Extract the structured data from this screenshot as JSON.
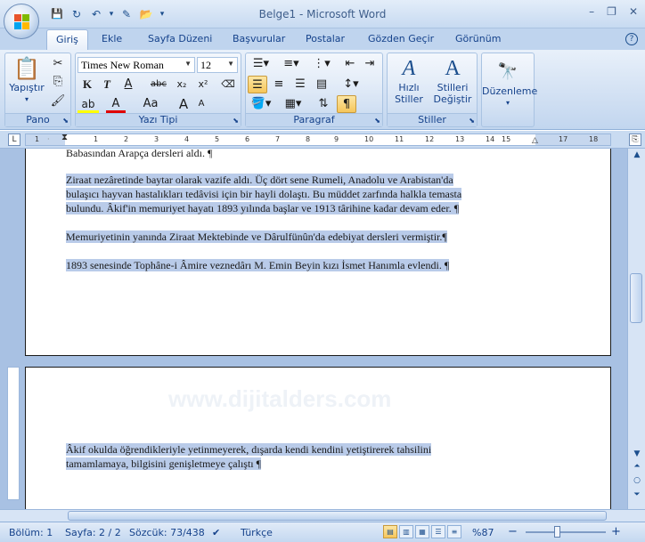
{
  "window": {
    "title": "Belge1 - Microsoft Word",
    "minimize": "–",
    "restore": "❐",
    "close": "✕"
  },
  "qat": {
    "save": "💾",
    "redo": "↻",
    "undo": "↶",
    "undo_arrow": "▾",
    "customize": "▾"
  },
  "tabs": [
    "Giriş",
    "Ekle",
    "Sayfa Düzeni",
    "Başvurular",
    "Postalar",
    "Gözden Geçir",
    "Görünüm"
  ],
  "help": "?",
  "ribbon": {
    "pano": {
      "label": "Pano",
      "paste": "Yapıştır"
    },
    "font": {
      "label": "Yazı Tipi",
      "name": "Times New Roman",
      "size": "12",
      "grow": "A",
      "shrink": "A",
      "bold": "K",
      "italic": "T",
      "underline": "A",
      "strike": "abc",
      "sub": "x₂",
      "sup": "x²",
      "case": "Aa",
      "color": "A"
    },
    "paragraph": {
      "label": "Paragraf",
      "pilcrow": "¶"
    },
    "styles": {
      "label": "Stiller",
      "quick": "Hızlı",
      "quick2": "Stiller",
      "change": "Stilleri",
      "change2": "Değiştir"
    },
    "edit": {
      "label": "Düzenleme"
    }
  },
  "ruler": {
    "tab_selector": "L",
    "numbers": [
      "1",
      "2",
      "1",
      "2",
      "3",
      "4",
      "5",
      "6",
      "7",
      "8",
      "9",
      "10",
      "11",
      "12",
      "13",
      "14",
      "15",
      "17",
      "18"
    ]
  },
  "document": {
    "page1": [
      {
        "text": "Babasından Arapça dersleri aldı. ¶",
        "selected": false
      },
      {
        "text": "Ziraat nezâretinde baytar olarak vazife aldı. Üç dört sene Rumeli, Anadolu ve Arabistan'da",
        "selected": true
      },
      {
        "text": "bulaşıcı hayvan hastalıkları tedâvisi için bir hayli dolaştı. Bu müddet zarfında halkla temasta",
        "selected": true
      },
      {
        "text": "bulundu. Âkif'in memuriyet hayatı 1893 yılında başlar ve 1913 târihine kadar devam eder. ¶",
        "selected": true
      },
      {
        "text": "Memuriyetinin yanında Ziraat Mektebinde ve Dârulfünûn'da edebiyat dersleri vermiştir.¶",
        "selected": true
      },
      {
        "text": "1893 senesinde Tophâne-i Âmire veznedârı M. Emin Beyin kızı İsmet Hanımla evlendi. ¶",
        "selected": true
      }
    ],
    "watermark": "www.dijitalders.com",
    "page2": [
      {
        "text": "Âkif okulda öğrendikleriyle yetinmeyerek, dışarda kendi kendini yetiştirerek tahsilini",
        "selected": true
      },
      {
        "text": "tamamlamaya, bilgisini genişletmeye çalıştı ¶",
        "selected": true
      }
    ]
  },
  "status": {
    "section": "Bölüm: 1",
    "page": "Sayfa: 2 / 2",
    "words": "Sözcük: 73/438",
    "language": "Türkçe",
    "zoom": "%87",
    "zoom_out": "−",
    "zoom_in": "+"
  }
}
